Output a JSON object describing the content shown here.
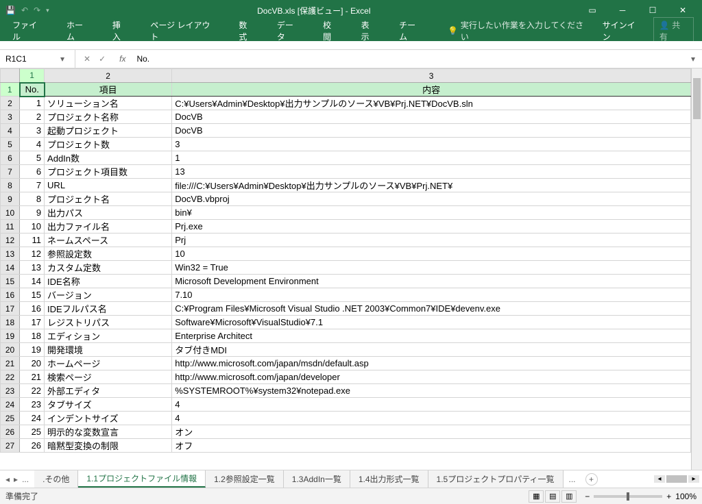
{
  "titlebar": {
    "title": "DocVB.xls  [保護ビュー] - Excel",
    "signin": "サインイン",
    "share": "共有"
  },
  "ribbon": {
    "tabs": [
      "ファイル",
      "ホーム",
      "挿入",
      "ページ レイアウト",
      "数式",
      "データ",
      "校閲",
      "表示",
      "チーム"
    ],
    "tellme": "実行したい作業を入力してください"
  },
  "namebox": "R1C1",
  "formula": "No.",
  "columns": [
    "1",
    "2",
    "3"
  ],
  "header_cells": [
    "No.",
    "項目",
    "内容"
  ],
  "rows": [
    {
      "n": "1",
      "no": "1",
      "item": "ソリューション名",
      "val": "C:¥Users¥Admin¥Desktop¥出力サンプルのソース¥VB¥Prj.NET¥DocVB.sln"
    },
    {
      "n": "2",
      "no": "2",
      "item": "プロジェクト名称",
      "val": "DocVB"
    },
    {
      "n": "3",
      "no": "3",
      "item": "起動プロジェクト",
      "val": "DocVB"
    },
    {
      "n": "4",
      "no": "4",
      "item": "プロジェクト数",
      "val": "3"
    },
    {
      "n": "5",
      "no": "5",
      "item": "AddIn数",
      "val": "1"
    },
    {
      "n": "6",
      "no": "6",
      "item": "プロジェクト項目数",
      "val": "13"
    },
    {
      "n": "7",
      "no": "7",
      "item": "URL",
      "val": "file:///C:¥Users¥Admin¥Desktop¥出力サンプルのソース¥VB¥Prj.NET¥"
    },
    {
      "n": "8",
      "no": "8",
      "item": "プロジェクト名",
      "val": "DocVB.vbproj"
    },
    {
      "n": "9",
      "no": "9",
      "item": "出力パス",
      "val": "bin¥"
    },
    {
      "n": "10",
      "no": "10",
      "item": "出力ファイル名",
      "val": "Prj.exe"
    },
    {
      "n": "11",
      "no": "11",
      "item": "ネームスペース",
      "val": "Prj"
    },
    {
      "n": "12",
      "no": "12",
      "item": "参照設定数",
      "val": "10"
    },
    {
      "n": "13",
      "no": "13",
      "item": "カスタム定数",
      "val": "Win32 = True"
    },
    {
      "n": "14",
      "no": "14",
      "item": "IDE名称",
      "val": "Microsoft Development Environment"
    },
    {
      "n": "15",
      "no": "15",
      "item": "バージョン",
      "val": "7.10"
    },
    {
      "n": "16",
      "no": "16",
      "item": "IDEフルパス名",
      "val": "C:¥Program Files¥Microsoft Visual Studio .NET 2003¥Common7¥IDE¥devenv.exe"
    },
    {
      "n": "17",
      "no": "17",
      "item": "レジストリパス",
      "val": "Software¥Microsoft¥VisualStudio¥7.1"
    },
    {
      "n": "18",
      "no": "18",
      "item": "エディション",
      "val": "Enterprise Architect"
    },
    {
      "n": "19",
      "no": "19",
      "item": "開発環境",
      "val": "タブ付きMDI"
    },
    {
      "n": "20",
      "no": "20",
      "item": "ホームページ",
      "val": "http://www.microsoft.com/japan/msdn/default.asp"
    },
    {
      "n": "21",
      "no": "21",
      "item": "検索ページ",
      "val": "http://www.microsoft.com/japan/developer"
    },
    {
      "n": "22",
      "no": "22",
      "item": "外部エディタ",
      "val": "%SYSTEMROOT%¥system32¥notepad.exe"
    },
    {
      "n": "23",
      "no": "23",
      "item": "タブサイズ",
      "val": "4"
    },
    {
      "n": "24",
      "no": "24",
      "item": "インデントサイズ",
      "val": "4"
    },
    {
      "n": "25",
      "no": "25",
      "item": "明示的な変数宣言",
      "val": "オン"
    },
    {
      "n": "26",
      "no": "26",
      "item": "暗黙型変換の制限",
      "val": "オフ"
    }
  ],
  "sheets": {
    "prev_label": "...",
    "tabs": [
      ".その他",
      "1.1プロジェクトファイル情報",
      "1.2参照設定一覧",
      "1.3AddIn一覧",
      "1.4出力形式一覧",
      "1.5プロジェクトプロパティ一覧"
    ],
    "active": 1,
    "more_label": "..."
  },
  "status": {
    "ready": "準備完了",
    "zoom": "100%"
  }
}
